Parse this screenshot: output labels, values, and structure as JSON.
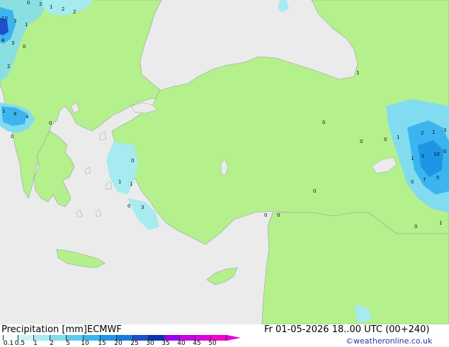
{
  "legend": {
    "title": "Precipitation [mm]",
    "model": "ECMWF",
    "ticks": [
      "0.1",
      "0.5",
      "1",
      "2",
      "5",
      "10",
      "15",
      "20",
      "25",
      "30",
      "35",
      "40",
      "45",
      "50"
    ],
    "colors": [
      "#f5fffa",
      "#cdf5f5",
      "#a5ebf0",
      "#82dcf0",
      "#5fc8f0",
      "#3cb4f0",
      "#1e96e6",
      "#1e78dc",
      "#1e50c8",
      "#0a32b4",
      "#9b00f5",
      "#c800e6",
      "#dc00dc",
      "#f000c8"
    ]
  },
  "valid_time": "Fr 01-05-2026 18..00 UTC (00+240)",
  "credit": "©weatheronline.co.uk",
  "map": {
    "sea_color": "#ebebeb",
    "land_color": "#b4f08c",
    "point_values": [
      "0",
      "2",
      "1",
      "2",
      "2",
      "10",
      "3",
      "1",
      "4",
      "3",
      "0",
      "2",
      "1",
      "4",
      "4",
      "0",
      "0",
      "0",
      "0",
      "1",
      "1",
      "0",
      "3",
      "1",
      "0",
      "0",
      "0",
      "0",
      "0",
      "0",
      "0",
      "1",
      "2",
      "1",
      "3",
      "1",
      "5",
      "10",
      "0",
      "7",
      "5",
      "1"
    ]
  }
}
